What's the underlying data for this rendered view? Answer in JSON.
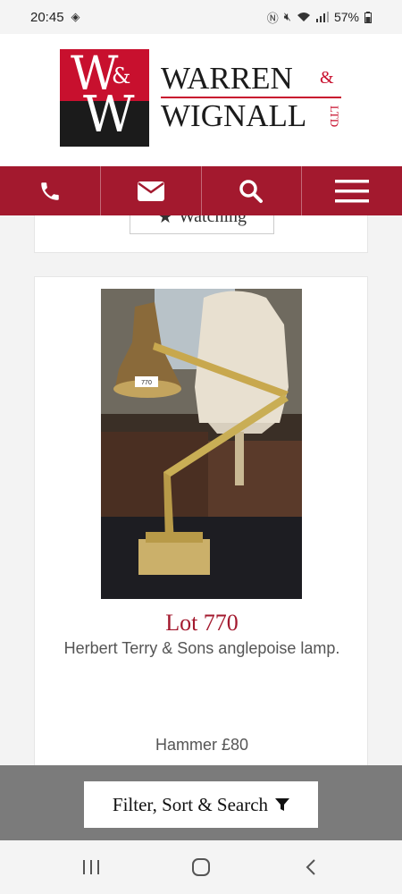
{
  "status_bar": {
    "time": "20:45",
    "battery": "57%"
  },
  "brand": {
    "logo_monogram_top": "W",
    "logo_ampersand": "&",
    "logo_monogram_bottom": "W",
    "name_line1": "WARREN",
    "ampersand": "&",
    "name_line2": "WIGNALL",
    "ltd": "LTD"
  },
  "nav": {
    "items": [
      {
        "icon": "phone-icon"
      },
      {
        "icon": "mail-icon"
      },
      {
        "icon": "search-icon"
      },
      {
        "icon": "menu-icon"
      }
    ],
    "color": "#a3192e"
  },
  "previous_card": {
    "watch_label": "Watching"
  },
  "lot": {
    "title": "Lot 770",
    "description": "Herbert Terry & Sons anglepoise lamp.",
    "hammer": "Hammer £80",
    "image_tag": "770"
  },
  "footer": {
    "filter_label": "Filter, Sort & Search"
  }
}
